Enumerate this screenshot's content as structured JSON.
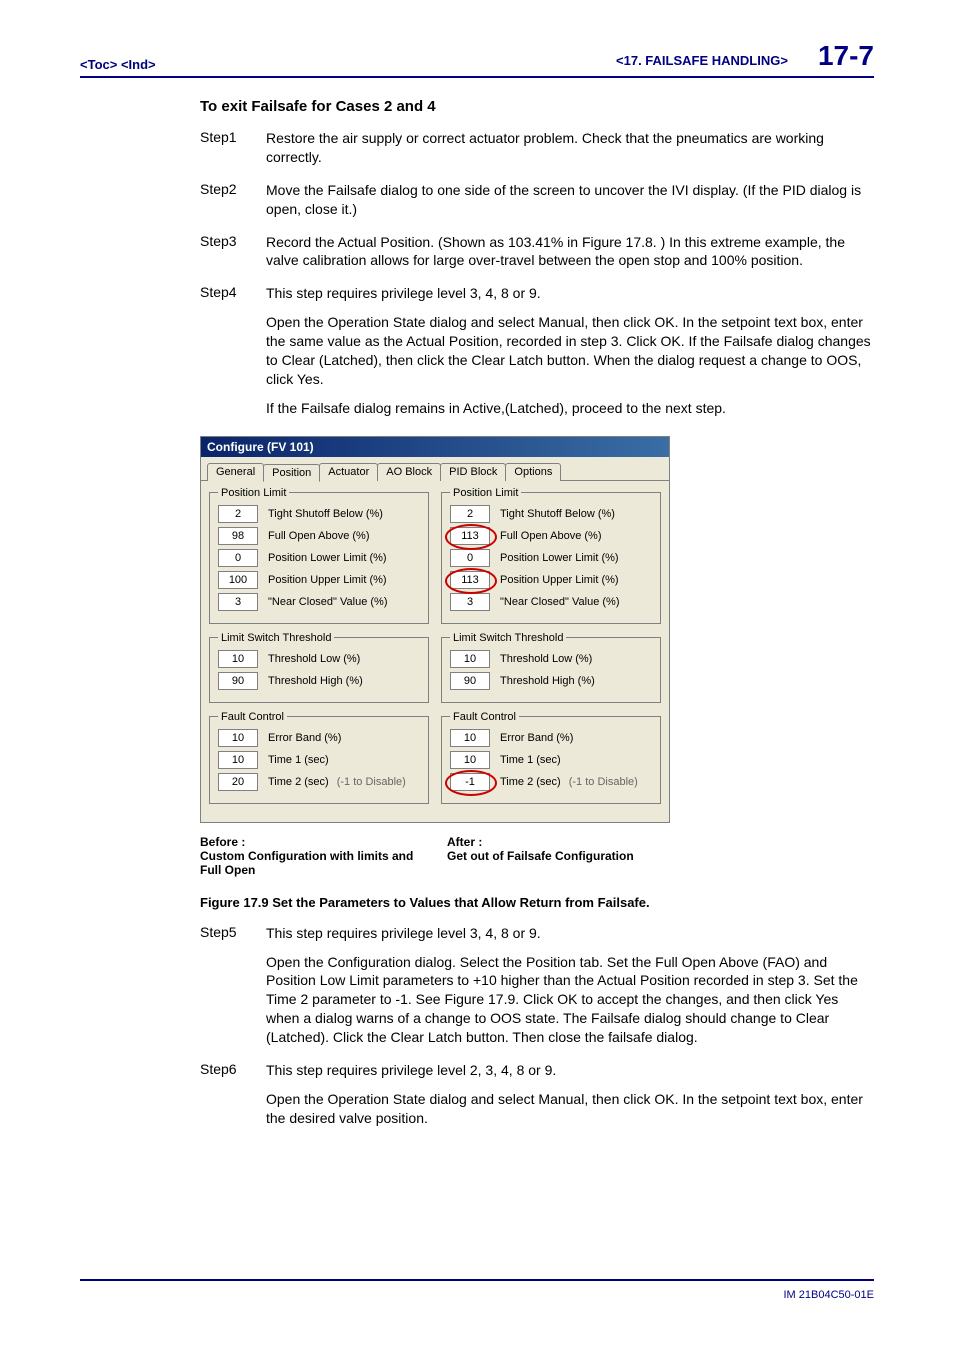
{
  "header": {
    "toc_ind": "<Toc> <Ind>",
    "section": "<17.  FAILSAFE HANDLING>",
    "page": "17-7"
  },
  "heading": "To exit Failsafe for Cases 2 and 4",
  "steps": {
    "s1": {
      "label": "Step1",
      "p1": "Restore the air supply or correct actuator problem.  Check that the pneumatics are working correctly."
    },
    "s2": {
      "label": "Step2",
      "p1": "Move the Failsafe dialog to one side of the screen to uncover the  IVI display.  (If the PID dialog is open, close it.)"
    },
    "s3": {
      "label": "Step3",
      "p1": "Record the Actual Position.  (Shown as 103.41% in Figure 17.8. )  In this extreme example, the valve calibration allows for large over-travel between the open stop and 100% position."
    },
    "s4": {
      "label": "Step4",
      "p1": "This step requires privilege level 3, 4, 8 or 9.",
      "p2": "Open the Operation State dialog and select Manual, then click OK.  In the setpoint text box, enter the same value as the Actual Position, recorded in step 3.  Click OK.  If the Failsafe dialog changes to Clear (Latched), then click the Clear Latch button.  When the dialog request a change to OOS, click Yes.",
      "p3": "If the Failsafe dialog remains in Active,(Latched), proceed to the next step."
    },
    "s5": {
      "label": "Step5",
      "p1": "This step requires privilege level 3, 4, 8 or 9.",
      "p2": "Open the Configuration dialog.  Select the Position tab.  Set the Full Open Above (FAO) and Position Low Limit parameters to +10 higher than the Actual Position recorded in step 3.  Set the Time 2 parameter to -1.  See Figure 17.9.  Click OK to accept the changes, and then click Yes when a dialog warns of a change to OOS state.  The Failsafe dialog should change to Clear (Latched).  Click the Clear Latch button.  Then close the failsafe dialog."
    },
    "s6": {
      "label": "Step6",
      "p1": "This step requires privilege level 2, 3, 4, 8 or 9.",
      "p2": "Open the Operation State dialog and select Manual, then click OK.  In the setpoint text box, enter the desired valve position."
    }
  },
  "dialog": {
    "title": "Configure (FV 101)",
    "tabs": [
      "General",
      "Position",
      "Actuator",
      "AO Block",
      "PID Block",
      "Options"
    ],
    "groups": {
      "g1": "Position Limit",
      "g2": "Limit Switch Threshold",
      "g3": "Fault Control"
    },
    "labels": {
      "tsb": "Tight Shutoff Below (%)",
      "foa": "Full Open Above (%)",
      "pll": "Position Lower Limit (%)",
      "pul": "Position Upper Limit (%)",
      "ncv": "\"Near Closed\" Value (%)",
      "tlo": "Threshold Low (%)",
      "thi": "Threshold High (%)",
      "eb": "Error Band (%)",
      "t1": "Time 1 (sec)",
      "t2": "Time 2 (sec)",
      "disnote": "(-1 to Disable)"
    },
    "before": {
      "tsb": "2",
      "foa": "98",
      "pll": "0",
      "pul": "100",
      "ncv": "3",
      "tlo": "10",
      "thi": "90",
      "eb": "10",
      "t1": "10",
      "t2": "20"
    },
    "after": {
      "tsb": "2",
      "foa": "113",
      "pll": "0",
      "pul": "113",
      "ncv": "3",
      "tlo": "10",
      "thi": "90",
      "eb": "10",
      "t1": "10",
      "t2": "-1"
    }
  },
  "captions": {
    "before_h": "Before :",
    "before_t": "Custom Configuration with limits and Full Open",
    "after_h": "After :",
    "after_t": "Get out of Failsafe Configuration"
  },
  "figure_caption": "Figure 17.9        Set the Parameters to Values that Allow Return from Failsafe.",
  "footer": "IM 21B04C50-01E"
}
